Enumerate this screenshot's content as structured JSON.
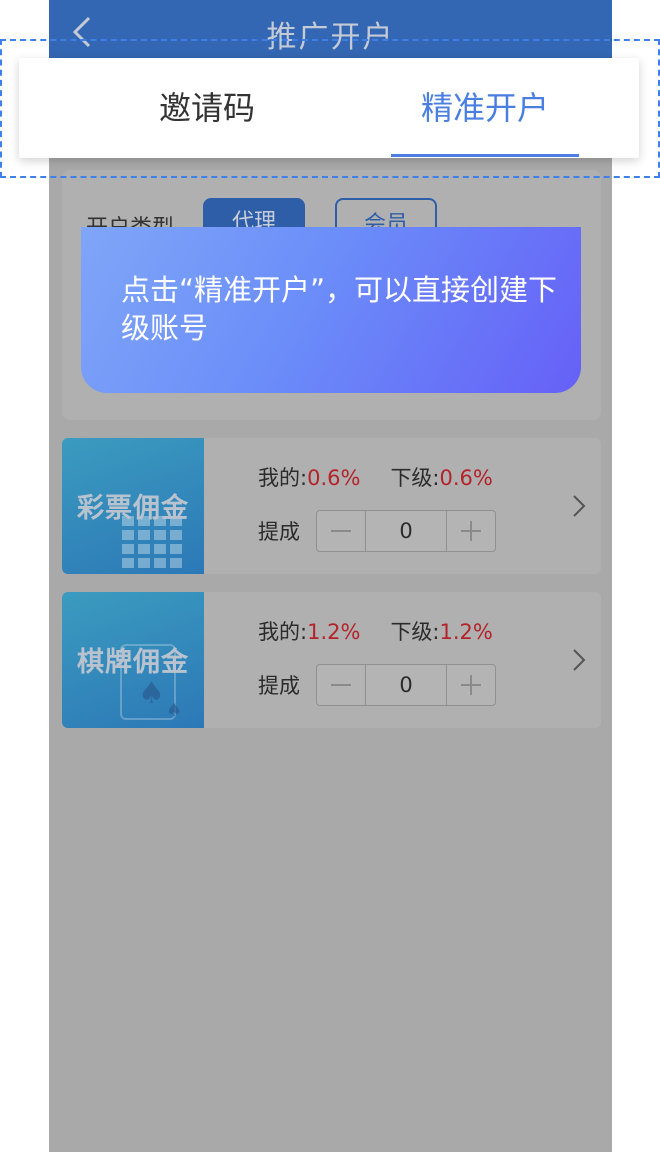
{
  "header": {
    "title": "推广开户"
  },
  "tabs": {
    "invite_code": "邀请码",
    "precise_account": "精准开户"
  },
  "account_type": {
    "label": "开户类型",
    "agent": "代理",
    "member": "会员"
  },
  "tooltip": {
    "text": "点击“精准开户”，可以直接创建下级账号"
  },
  "commissions": [
    {
      "name": "彩票佣金",
      "mine_label": "我的:",
      "mine_value": "0.6%",
      "sub_label": "下级:",
      "sub_value": "0.6%",
      "tc_label": "提成",
      "value": "0"
    },
    {
      "name": "棋牌佣金",
      "mine_label": "我的:",
      "mine_value": "1.2%",
      "sub_label": "下级:",
      "sub_value": "1.2%",
      "tc_label": "提成",
      "value": "0"
    }
  ],
  "icons": {
    "back": "chevron-left-icon",
    "more": "chevron-right-icon",
    "minus": "minus-icon",
    "plus": "plus-icon"
  },
  "colors": {
    "nav": "#3366b3",
    "accent": "#4a7fe0",
    "rate": "#b4232a",
    "overlay": "#a9a9a9"
  }
}
